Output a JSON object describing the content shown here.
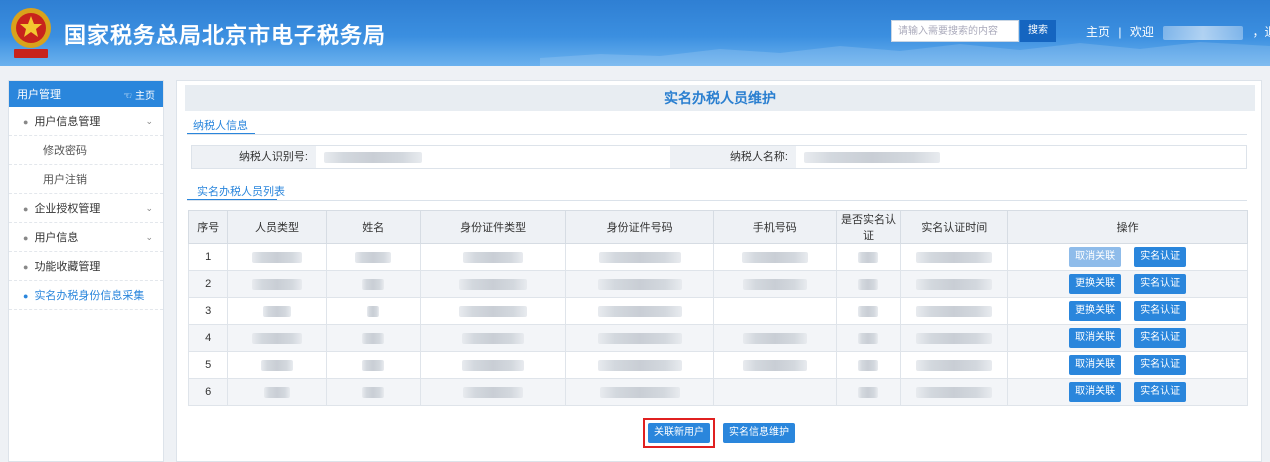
{
  "header": {
    "title": "国家税务总局北京市电子税务局",
    "search_placeholder": "请输入需要搜索的内容",
    "search_label": "搜索",
    "home_label": "主页",
    "separator": "|",
    "welcome_label": "欢迎",
    "logout_label": "，退出",
    "colors": {
      "bar": "#3b8fe0",
      "accent": "#2a86dc"
    }
  },
  "sidebar": {
    "header": "用户管理",
    "home_label": "主页",
    "items": [
      {
        "label": "用户信息管理",
        "type": "group",
        "expanded": true
      },
      {
        "label": "修改密码",
        "type": "sub"
      },
      {
        "label": "用户注销",
        "type": "sub"
      },
      {
        "label": "企业授权管理",
        "type": "group"
      },
      {
        "label": "用户信息",
        "type": "group"
      },
      {
        "label": "功能收藏管理",
        "type": "leaf"
      },
      {
        "label": "实名办税身份信息采集",
        "type": "leaf",
        "active": true
      }
    ]
  },
  "main": {
    "title": "实名办税人员维护",
    "tab_taxpayer": "纳税人信息",
    "taxpayer_id_label": "纳税人识别号:",
    "taxpayer_name_label": "纳税人名称:",
    "tab_list": "实名办税人员列表",
    "columns": [
      "序号",
      "人员类型",
      "姓名",
      "身份证件类型",
      "身份证件号码",
      "手机号码",
      "是否实名认证",
      "实名认证时间",
      "操作"
    ],
    "rows": [
      {
        "no": "1",
        "op1": "取消关联",
        "op1_disabled": true,
        "op2": "实名认证"
      },
      {
        "no": "2",
        "op1": "更换关联",
        "op2": "实名认证"
      },
      {
        "no": "3",
        "op1": "更换关联",
        "op2": "实名认证"
      },
      {
        "no": "4",
        "op1": "取消关联",
        "op2": "实名认证"
      },
      {
        "no": "5",
        "op1": "取消关联",
        "op2": "实名认证"
      },
      {
        "no": "6",
        "op1": "取消关联",
        "op2": "实名认证"
      }
    ],
    "btn_link_new": "关联新用户",
    "btn_maintain": "实名信息维护"
  }
}
